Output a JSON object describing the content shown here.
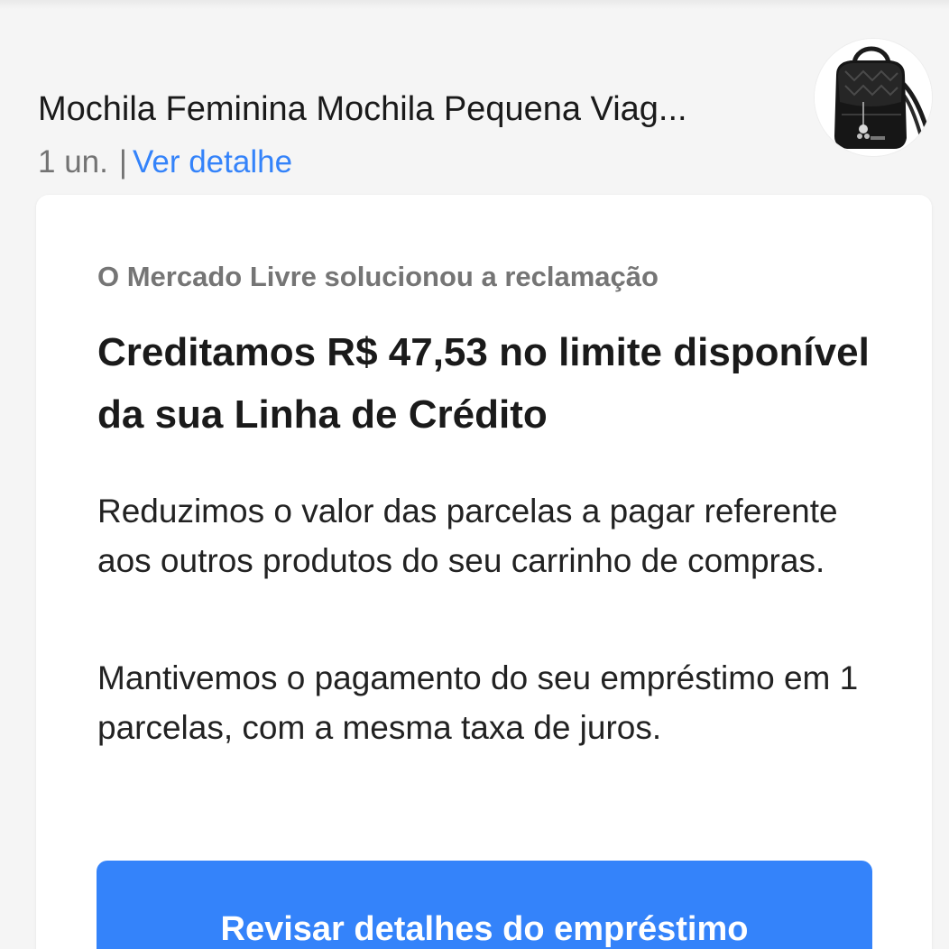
{
  "product": {
    "title": "Mochila Feminina Mochila Pequena Viag...",
    "quantity": "1 un.",
    "separator": "|",
    "details_link": "Ver detalhe",
    "image_icon": "backpack-image"
  },
  "claim_card": {
    "eyebrow": "O Mercado Livre solucionou a reclamação",
    "headline": "Creditamos R$ 47,53 no limite disponível da sua Linha de Crédito",
    "paragraph_1": "Reduzimos o valor das parcelas a pagar referente aos outros produtos do seu carrinho de compras.",
    "paragraph_2": "Mantivemos o pagamento do seu empréstimo em 1 parcelas, com a mesma taxa de juros.",
    "cta_label": "Revisar detalhes do empréstimo"
  },
  "colors": {
    "accent": "#3483fa",
    "background": "#f5f5f5",
    "card": "#ffffff",
    "muted_text": "#737373"
  }
}
